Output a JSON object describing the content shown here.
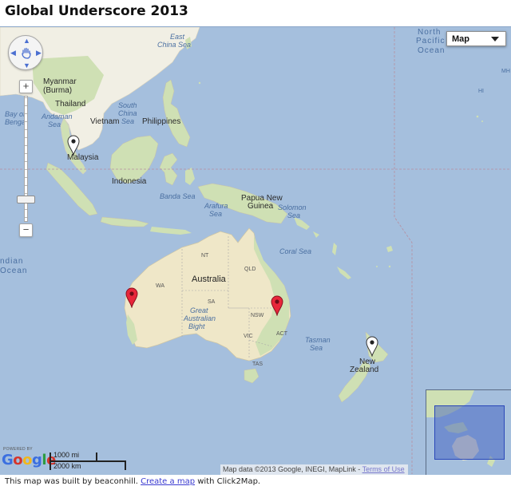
{
  "page": {
    "title": "Global Underscore 2013"
  },
  "map": {
    "type_control": {
      "selected": "Map"
    },
    "zoom": {
      "plus": "+",
      "minus": "−"
    },
    "labels": {
      "countries": [
        {
          "id": "myanmar",
          "text": "Myanmar"
        },
        {
          "id": "burma",
          "text": "(Burma)"
        },
        {
          "id": "thailand",
          "text": "Thailand"
        },
        {
          "id": "vietnam",
          "text": "Vietnam"
        },
        {
          "id": "philippines",
          "text": "Philippines"
        },
        {
          "id": "malaysia",
          "text": "Malaysia"
        },
        {
          "id": "indonesia",
          "text": "Indonesia"
        },
        {
          "id": "png1",
          "text": "Papua New"
        },
        {
          "id": "png2",
          "text": "Guinea"
        },
        {
          "id": "australia",
          "text": "Australia"
        },
        {
          "id": "nz1",
          "text": "New"
        },
        {
          "id": "nz2",
          "text": "Zealand"
        }
      ],
      "seas": [
        {
          "id": "east-china-sea1",
          "text": "East"
        },
        {
          "id": "east-china-sea2",
          "text": "China Sea"
        },
        {
          "id": "bay-of-bengal1",
          "text": "Bay of"
        },
        {
          "id": "bay-of-bengal2",
          "text": "Bengal"
        },
        {
          "id": "andaman-sea1",
          "text": "Andaman"
        },
        {
          "id": "andaman-sea2",
          "text": "Sea"
        },
        {
          "id": "south-china-sea1",
          "text": "South"
        },
        {
          "id": "south-china-sea2",
          "text": "China"
        },
        {
          "id": "south-china-sea3",
          "text": "Sea"
        },
        {
          "id": "banda-sea",
          "text": "Banda Sea"
        },
        {
          "id": "arafura-sea1",
          "text": "Arafura"
        },
        {
          "id": "arafura-sea2",
          "text": "Sea"
        },
        {
          "id": "solomon-sea1",
          "text": "Solomon"
        },
        {
          "id": "solomon-sea2",
          "text": "Sea"
        },
        {
          "id": "coral-sea",
          "text": "Coral Sea"
        },
        {
          "id": "great-aus-bight1",
          "text": "Great"
        },
        {
          "id": "great-aus-bight2",
          "text": "Australian"
        },
        {
          "id": "great-aus-bight3",
          "text": "Bight"
        },
        {
          "id": "tasman-sea1",
          "text": "Tasman"
        },
        {
          "id": "tasman-sea2",
          "text": "Sea"
        }
      ],
      "oceans": [
        {
          "id": "north-pacific1",
          "text": "North"
        },
        {
          "id": "north-pacific2",
          "text": "Pacific"
        },
        {
          "id": "north-pacific3",
          "text": "Ocean"
        },
        {
          "id": "indian-ocean1",
          "text": "ndian"
        },
        {
          "id": "indian-ocean2",
          "text": "Ocean"
        }
      ],
      "states": [
        {
          "id": "nt",
          "text": "NT"
        },
        {
          "id": "qld",
          "text": "QLD"
        },
        {
          "id": "wa",
          "text": "WA"
        },
        {
          "id": "sa",
          "text": "SA"
        },
        {
          "id": "nsw",
          "text": "NSW"
        },
        {
          "id": "act",
          "text": "ACT"
        },
        {
          "id": "vic",
          "text": "VIC"
        },
        {
          "id": "tas",
          "text": "TAS"
        }
      ],
      "islands": [
        {
          "id": "mh",
          "text": "MH"
        },
        {
          "id": "hi",
          "text": "HI"
        }
      ]
    },
    "markers": [
      {
        "id": "malaysia",
        "color": "#ffffff"
      },
      {
        "id": "perth",
        "color": "#e8263a"
      },
      {
        "id": "sydney",
        "color": "#e8263a"
      },
      {
        "id": "new-zealand",
        "color": "#ffffff"
      }
    ],
    "colors": {
      "water": "#a5bfdd",
      "land": "#f1efe4",
      "land_green": "#c9dcae",
      "land_australia": "#efe7c8",
      "marker_red": "#e8263a",
      "marker_white": "#ffffff"
    },
    "scale": {
      "miles": "1000 mi",
      "km": "2000 km"
    },
    "logo": {
      "powered": "POWERED BY",
      "word": "Google"
    },
    "attribution": {
      "text": "Map data ©2013 Google, INEGI, MapLink - ",
      "terms": "Terms of Use"
    }
  },
  "footer": {
    "prefix": "This map was built by beaconhill. ",
    "link": "Create a map",
    "suffix": " with Click2Map."
  }
}
